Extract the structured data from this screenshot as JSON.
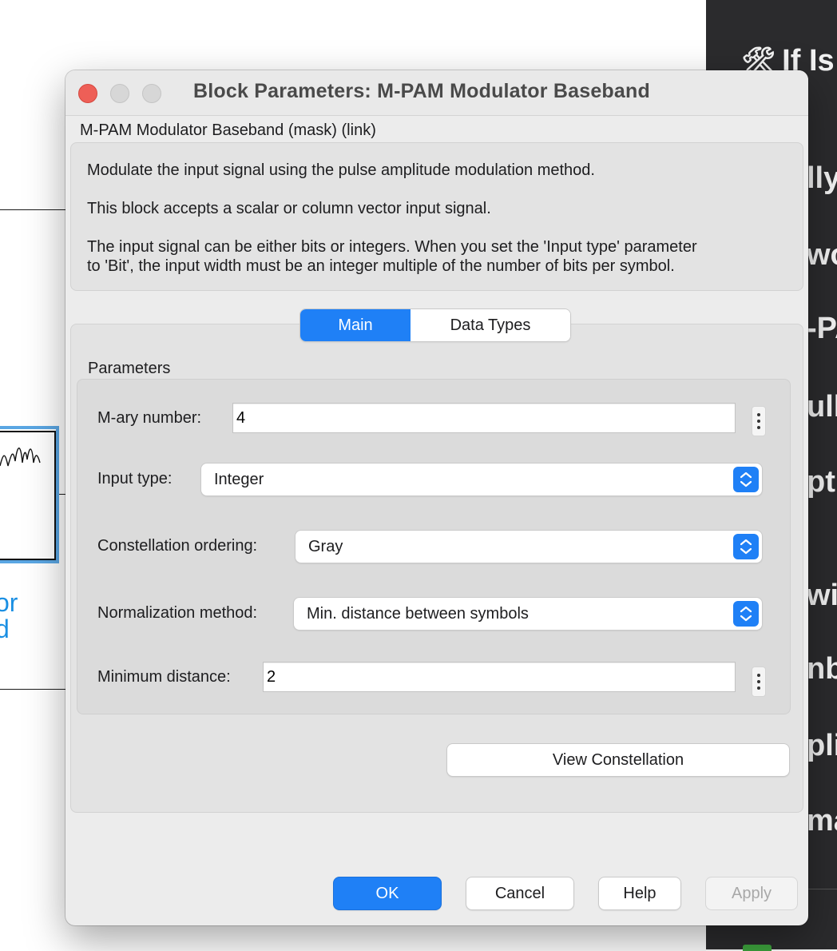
{
  "background_canvas": {
    "block_label_line1": "or",
    "block_label_line2": "d"
  },
  "right_panel": {
    "title_icon": "hammer-wrench-icon",
    "title": "If Is",
    "fragments": [
      "lly",
      "wo",
      "-PA",
      "ull s",
      "pt",
      "wil",
      "nbo",
      "plit",
      "ma"
    ]
  },
  "dialog": {
    "title": "Block Parameters: M-PAM Modulator Baseband",
    "mask_heading": "M-PAM Modulator Baseband (mask) (link)",
    "description": {
      "line1": "Modulate the input signal using the pulse amplitude modulation method.",
      "line2": "This block accepts a scalar or column vector input signal.",
      "line3a": "The input signal can be either bits or integers. When you set the 'Input type' parameter",
      "line3b": "to 'Bit', the input width must be an integer multiple of the number of bits per symbol."
    },
    "tabs": [
      {
        "label": "Main",
        "selected": true
      },
      {
        "label": "Data Types",
        "selected": false
      }
    ],
    "parameters_label": "Parameters",
    "fields": {
      "mary_number": {
        "label": "M-ary number:",
        "value": "4"
      },
      "input_type": {
        "label": "Input type:",
        "value": "Integer"
      },
      "constellation_ordering": {
        "label": "Constellation ordering:",
        "value": "Gray"
      },
      "normalization_method": {
        "label": "Normalization method:",
        "value": "Min. distance between symbols"
      },
      "minimum_distance": {
        "label": "Minimum distance:",
        "value": "2"
      }
    },
    "view_constellation": "View Constellation",
    "buttons": {
      "ok": "OK",
      "cancel": "Cancel",
      "help": "Help",
      "apply": "Apply"
    }
  },
  "colors": {
    "accent": "#1f80f6",
    "close": "#ee5f57",
    "link_blue": "#1a8fe3",
    "dark_panel": "#2b2b2d"
  }
}
